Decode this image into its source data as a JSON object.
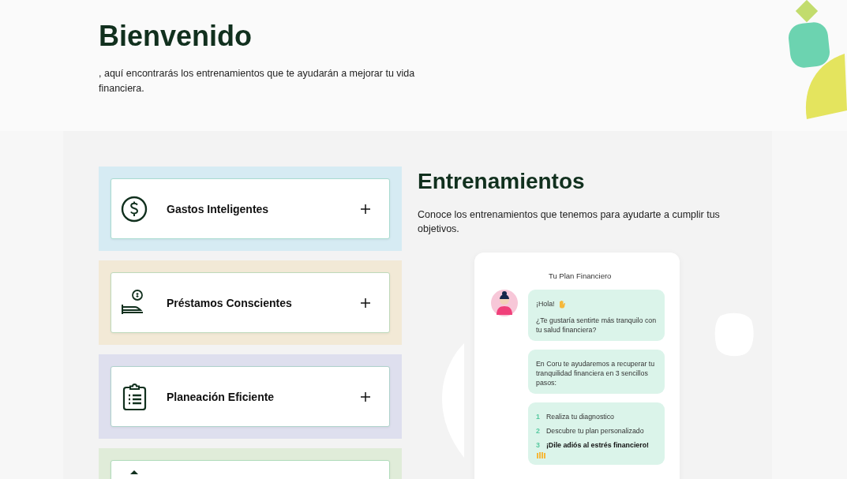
{
  "header": {
    "title": "Bienvenido",
    "subtitle": ", aquí encontrarás los entrenamientos que te ayudarán a mejorar tu vida financiera."
  },
  "trainings": [
    {
      "kind": "dollar",
      "title": "Gastos Inteligentes",
      "color": "#d6ebf3"
    },
    {
      "kind": "loan",
      "title": "Préstamos Conscientes",
      "color": "#f2e9d6"
    },
    {
      "kind": "clipboard",
      "title": "Planeación Eficiente",
      "color": "#dedfee"
    },
    {
      "kind": "partial",
      "color": "#e0ecd9"
    }
  ],
  "section": {
    "title": "Entrenamientos",
    "description": "Conoce los entrenamientos que tenemos para ayudarte a cumplir tus objetivos."
  },
  "chat": {
    "title": "Tu Plan Financiero",
    "greeting": "¡Hola!",
    "question": "¿Te gustaría sentirte más tranquilo con tu salud financiera?",
    "message": "En Coru te ayudaremos a recuperar tu tranquilidad financiera en 3 sencillos pasos:",
    "steps": [
      {
        "number": "1",
        "text": "Realiza tu diagnostico",
        "emphasis": false
      },
      {
        "number": "2",
        "text": "Descubre tu plan personalizado",
        "emphasis": false
      },
      {
        "number": "3",
        "text": "¡Dile adiós al estrés financiero!",
        "emphasis": true
      }
    ]
  }
}
